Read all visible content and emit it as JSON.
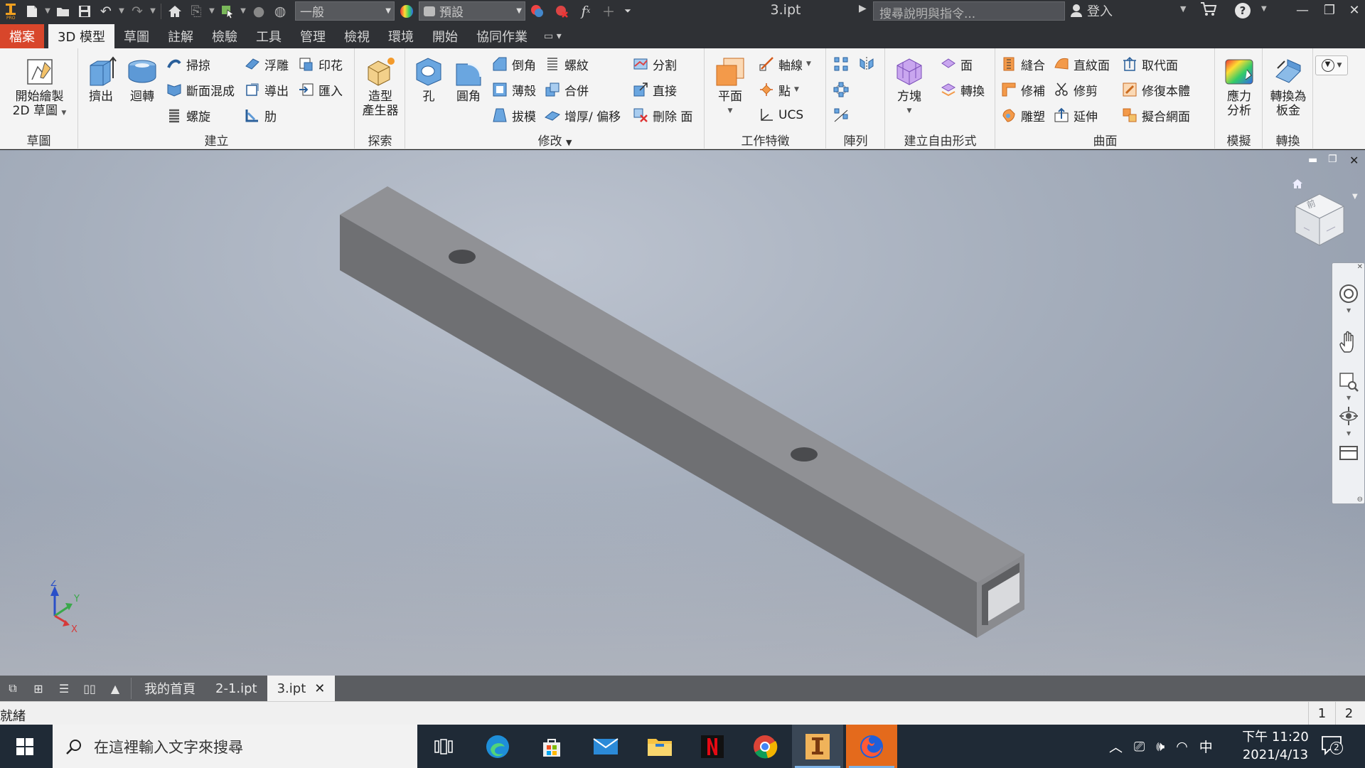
{
  "titlebar": {
    "style_combo": "一般",
    "appearance_combo": "預設",
    "document_title": "3.ipt",
    "search_placeholder": "搜尋說明與指令...",
    "signin_label": "登入"
  },
  "ribbon_tabs": [
    "檔案",
    "3D 模型",
    "草圖",
    "註解",
    "檢驗",
    "工具",
    "管理",
    "檢視",
    "環境",
    "開始",
    "協同作業"
  ],
  "active_tab": "3D 模型",
  "panels": {
    "sketch": {
      "title": "草圖",
      "start_sketch_line1": "開始繪製",
      "start_sketch_line2": "2D 草圖"
    },
    "create": {
      "title": "建立",
      "extrude": "擠出",
      "revolve": "迴轉",
      "sweep": "掃掠",
      "loft": "斷面混成",
      "coil": "螺旋",
      "emboss": "浮雕",
      "derive": "導出",
      "rib": "肋",
      "decal": "印花",
      "import": "匯入"
    },
    "explore": {
      "title": "探索",
      "shape_gen_line1": "造型",
      "shape_gen_line2": "產生器"
    },
    "modify": {
      "title": "修改",
      "hole": "孔",
      "fillet": "圓角",
      "chamfer": "倒角",
      "shell": "薄殼",
      "draft": "拔模",
      "thread": "螺紋",
      "combine": "合併",
      "thicken": "增厚/ 偏移",
      "split": "分割",
      "direct": "直接",
      "delete_face": "刪除 面"
    },
    "work_features": {
      "title": "工作特徵",
      "plane": "平面",
      "axis": "軸線",
      "point": "點",
      "ucs": "UCS"
    },
    "pattern": {
      "title": "陣列"
    },
    "freeform": {
      "title": "建立自由形式",
      "box": "方塊",
      "face": "面",
      "convert": "轉換"
    },
    "surface": {
      "title": "曲面",
      "stitch": "縫合",
      "patch": "修補",
      "sculpt": "雕塑",
      "ruled": "直紋面",
      "trim": "修剪",
      "extend": "延伸",
      "replace_face": "取代面",
      "repair_bodies": "修復本體",
      "fit_mesh_face": "擬合網面"
    },
    "simulation": {
      "title": "模擬",
      "stress_line1": "應力",
      "stress_line2": "分析"
    },
    "convert": {
      "title": "轉換",
      "sheet_metal_line1": "轉換為",
      "sheet_metal_line2": "板金"
    }
  },
  "viewcube": {
    "face_label": "前"
  },
  "axes": {
    "x": "X",
    "y": "Y",
    "z": "Z"
  },
  "document_tabs": [
    "我的首頁",
    "2-1.ipt",
    "3.ipt"
  ],
  "active_document": "3.ipt",
  "status": {
    "text": "就緒",
    "num1": "1",
    "num2": "2"
  },
  "taskbar": {
    "search_placeholder": "在這裡輸入文字來搜尋",
    "ime": "中",
    "time": "下午 11:20",
    "date": "2021/4/13",
    "notifications": "2"
  },
  "colors": {
    "file_tab": "#d8462b",
    "part_body": "#6f7073",
    "viewport_bg": "#a4adbb"
  }
}
